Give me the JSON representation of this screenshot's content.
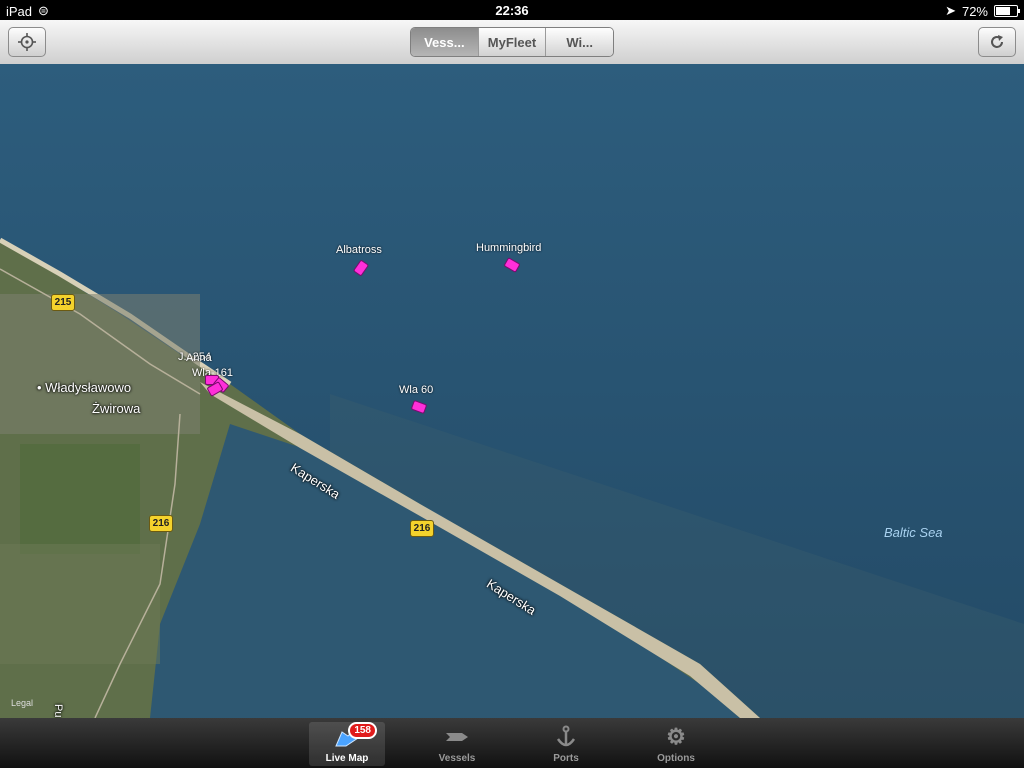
{
  "status": {
    "device": "iPad",
    "time": "22:36",
    "battery": "72%",
    "battery_level": 0.72
  },
  "nav": {
    "segments": [
      {
        "label": "Vess...",
        "active": true
      },
      {
        "label": "MyFleet",
        "active": false
      },
      {
        "label": "Wi...",
        "active": false
      }
    ]
  },
  "map": {
    "vessels": [
      {
        "name": "Albatross"
      },
      {
        "name": "Hummingbird"
      },
      {
        "name": "Wla 60"
      },
      {
        "name": "Wla-161"
      },
      {
        "name": "J...254"
      },
      {
        "name": "Anna"
      }
    ],
    "places": {
      "town1": "Władysławowo",
      "town2": "Żwirowa",
      "street1": "Kaperska",
      "street2": "Kaperska",
      "side_road": "Pu"
    },
    "roads": [
      "215",
      "216",
      "216"
    ],
    "sea_label": "Baltic Sea",
    "legal": "Legal"
  },
  "tabbar": {
    "tabs": [
      {
        "label": "Live Map",
        "badge": "158",
        "active": true
      },
      {
        "label": "Vessels",
        "active": false
      },
      {
        "label": "Ports",
        "active": false
      },
      {
        "label": "Options",
        "active": false
      }
    ]
  },
  "colors": {
    "vessel": "#ff2fd9",
    "sea": "#2b5573",
    "land": "#6b7a4e",
    "badge": "#e01b1b"
  }
}
